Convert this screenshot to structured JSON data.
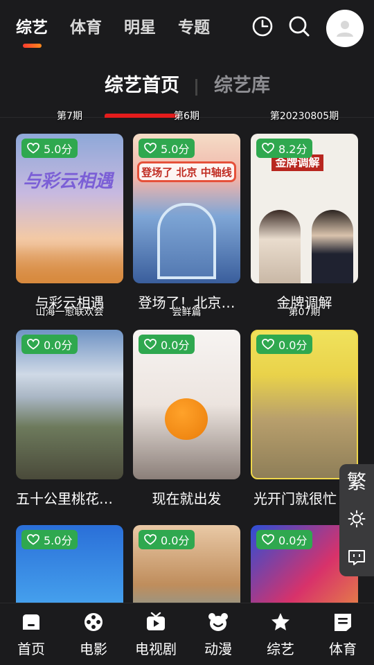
{
  "nav": {
    "tabs": [
      {
        "label": "综艺",
        "active": true
      },
      {
        "label": "体育"
      },
      {
        "label": "明星"
      },
      {
        "label": "专题"
      }
    ],
    "accent": "#ff5a26"
  },
  "subtabs": {
    "home_label": "综艺首页",
    "library_label": "综艺库"
  },
  "cards": [
    {
      "rating": "5.0分",
      "episode": "第7期",
      "title": "与彩云相遇",
      "poster_text": "与彩云相遇"
    },
    {
      "rating": "5.0分",
      "episode": "第6期",
      "title": "登场了！北京…",
      "poster_text": "登场了 北京 中轴线"
    },
    {
      "rating": "8.2分",
      "episode": "第20230805期",
      "title": "金牌调解",
      "poster_text": "金牌调解"
    },
    {
      "rating": "0.0分",
      "episode": "山海一愈联欢会",
      "title": "五十公里桃花…",
      "poster_text": ""
    },
    {
      "rating": "0.0分",
      "episode": "尝鲜篇",
      "title": "现在就出发",
      "poster_text": ""
    },
    {
      "rating": "0.0分",
      "episode": "第07期",
      "title": "光开门就很忙",
      "poster_text": ""
    },
    {
      "rating": "5.0分",
      "episode": "",
      "title": "",
      "poster_text": ""
    },
    {
      "rating": "0.0分",
      "episode": "",
      "title": "",
      "poster_text": ""
    },
    {
      "rating": "0.0分",
      "episode": "",
      "title": "",
      "poster_text": ""
    }
  ],
  "side_tools": {
    "traditional_label": "繁"
  },
  "bottom_nav": [
    {
      "label": "首页",
      "icon": "home-icon"
    },
    {
      "label": "电影",
      "icon": "film-reel-icon"
    },
    {
      "label": "电视剧",
      "icon": "tv-icon"
    },
    {
      "label": "动漫",
      "icon": "bear-icon"
    },
    {
      "label": "综艺",
      "icon": "star-icon"
    },
    {
      "label": "体育",
      "icon": "document-icon"
    }
  ],
  "colors": {
    "background": "#1b1b1d",
    "rating_badge": "#2fa84f",
    "subtab_underline": "#e41c1c"
  }
}
